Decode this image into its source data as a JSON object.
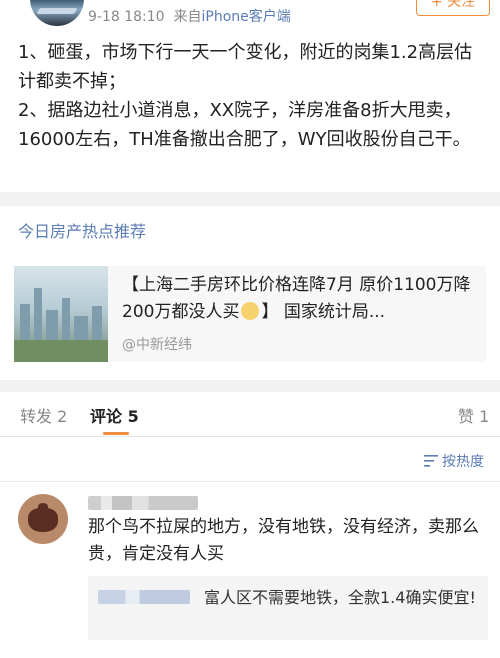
{
  "post": {
    "time": "9-18 18:10",
    "source_prefix": "来自",
    "source": "iPhone客户端",
    "follow_label": "+ 关注",
    "paragraphs": [
      "1、砸蛋，市场下行一天一个变化，附近的岗集1.2高层估计都卖不掉；",
      "2、据路边社小道消息，XX院子，洋房准备8折大甩卖，16000左右，TH准备撤出合肥了，WY回收股份自己干。"
    ]
  },
  "hot": {
    "title": "今日房产热点推荐",
    "news_title_before": "【上海二手房环比价格连降7月 原价1100万降200万都没人买",
    "news_title_after": "】 国家统计局...",
    "news_source": "@中新经纬"
  },
  "tabs": {
    "repost": "转发 2",
    "comment": "评论 5",
    "like": "赞 1"
  },
  "sort": {
    "label": "按热度"
  },
  "comment": {
    "text": "那个鸟不拉屎的地方，没有地铁，没有经济，卖那么贵，肯定没有人买",
    "reply_text": "富人区不需要地铁，全款1.4确实便宜!"
  },
  "colors": {
    "accent": "#f08c3c",
    "link": "#5b7db5"
  }
}
